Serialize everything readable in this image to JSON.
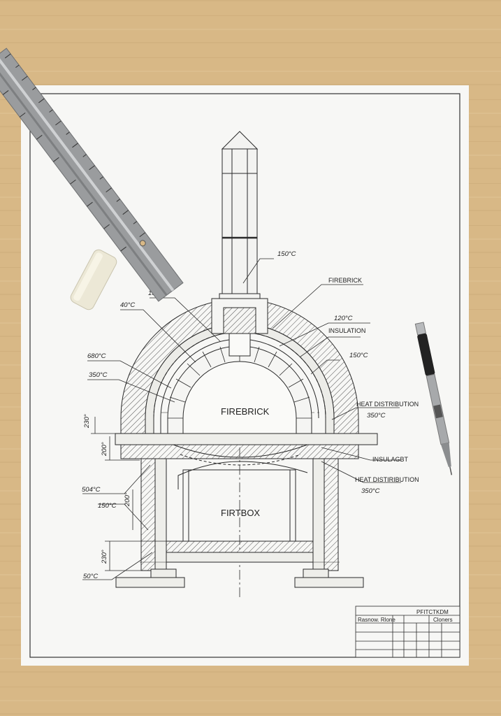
{
  "drawing": {
    "title_area": {
      "title": "FIREBRICK",
      "firebox": "FIRTBOX"
    },
    "labels": {
      "t_150_top": "150°C",
      "firebrick": "FIREBRICK",
      "t_132": "132FE",
      "t_40": "40°C",
      "t_120": "120°C",
      "insulation": "INSULATION",
      "t_150_right": "150°C",
      "t_680": "680°C",
      "t_350_left": "350°C",
      "heat_dist_1": "HEAT DISTRIBUTION",
      "t_350_right1": "350°C",
      "dim_230_top": "230°",
      "dim_200_left": "200°",
      "insulagbt": "INSULAGBT",
      "heat_dist_2": "HEAT DISTIRIBUTION",
      "t_350_right2": "350°C",
      "t_504": "504°C",
      "t_150_left": "150°C",
      "dim_200_mid": "200°",
      "dim_230_bot": "230°",
      "t_50": "50°C"
    },
    "title_block": {
      "header": "PFITCTKDM",
      "row_left": "Rasnow. Rlone",
      "row_right": "Cloners"
    }
  },
  "desk_items": [
    "ruler",
    "eraser",
    "mechanical-pencil"
  ],
  "colors": {
    "wood": "#d9b987",
    "paper": "#f7f7f5",
    "ink": "#2a2a2a"
  }
}
